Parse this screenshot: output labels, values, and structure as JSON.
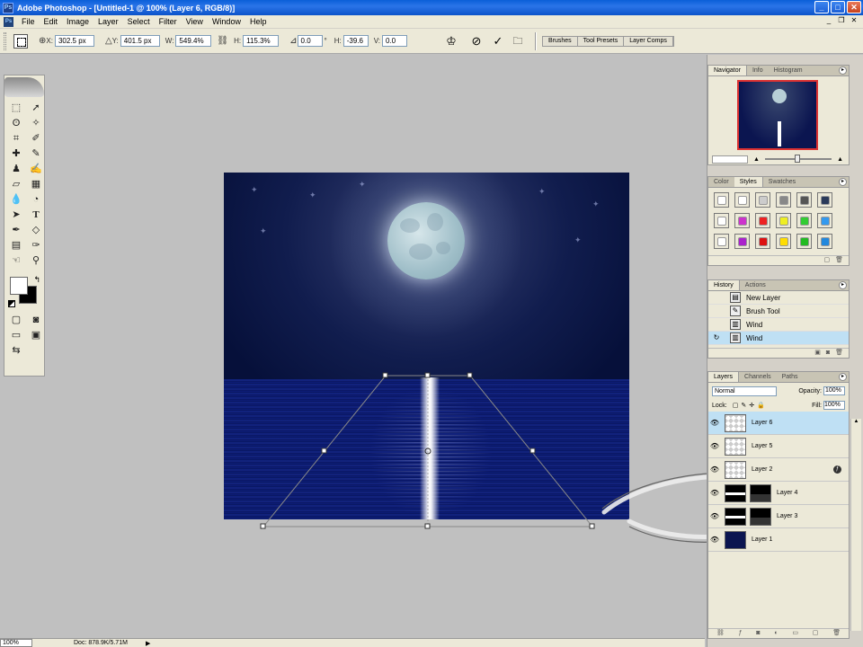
{
  "window": {
    "title": "Adobe Photoshop - [Untitled-1 @ 100% (Layer 6, RGB/8)]",
    "app_icon": "Ps"
  },
  "menu": {
    "items": [
      "File",
      "Edit",
      "Image",
      "Layer",
      "Select",
      "Filter",
      "View",
      "Window",
      "Help"
    ]
  },
  "options": {
    "x_label": "X:",
    "x_value": "302.5 px",
    "y_label": "Y:",
    "y_value": "401.5 px",
    "w_label": "W:",
    "w_value": "549.4%",
    "h_label": "H:",
    "h_value": "115.3%",
    "angle_value": "0.0",
    "h_skew_label": "H:",
    "h_skew_value": "-39.6",
    "v_skew_label": "V:",
    "v_skew_value": "0.0",
    "well_tabs": [
      "Brushes",
      "Tool Presets",
      "Layer Comps"
    ]
  },
  "navigator": {
    "tabs": [
      "Navigator",
      "Info",
      "Histogram"
    ]
  },
  "styles": {
    "tabs": [
      "Color",
      "Styles",
      "Swatches"
    ],
    "colors": [
      "#ffffff",
      "#ffffff",
      "#cccccc",
      "#888888",
      "#555555",
      "#2a3a5a",
      "#ffffff",
      "#cc33cc",
      "#ee2222",
      "#eeee22",
      "#33cc33",
      "#3399ee",
      "#ffffff",
      "#aa22cc",
      "#dd1111",
      "#ffdd00",
      "#22bb22",
      "#2288dd"
    ]
  },
  "history": {
    "tabs": [
      "History",
      "Actions"
    ],
    "items": [
      {
        "label": "New Layer",
        "icon": "new-layer-icon"
      },
      {
        "label": "Brush Tool",
        "icon": "brush-icon"
      },
      {
        "label": "Wind",
        "icon": "filter-icon"
      },
      {
        "label": "Wind",
        "icon": "filter-icon"
      }
    ]
  },
  "layers": {
    "tabs": [
      "Layers",
      "Channels",
      "Paths"
    ],
    "blend_mode": "Normal",
    "opacity_label": "Opacity:",
    "opacity_value": "100%",
    "fill_label": "Fill:",
    "fill_value": "100%",
    "items": [
      {
        "name": "Layer 6",
        "selected": true
      },
      {
        "name": "Layer 5"
      },
      {
        "name": "Layer 2"
      },
      {
        "name": "Layer 4"
      },
      {
        "name": "Layer 3"
      },
      {
        "name": "Layer 1"
      }
    ]
  },
  "status": {
    "zoom": "100%",
    "doc": "Doc: 878.9K/5.71M"
  },
  "icons": {
    "tool_icons": [
      "marquee-icon",
      "move-icon",
      "lasso-icon",
      "magic-wand-icon",
      "crop-icon",
      "slice-icon",
      "healing-icon",
      "brush-icon",
      "stamp-icon",
      "history-brush-icon",
      "eraser-icon",
      "gradient-icon",
      "blur-icon",
      "dodge-icon",
      "path-select-icon",
      "type-icon",
      "pen-icon",
      "shape-icon",
      "notes-icon",
      "eyedropper-icon",
      "hand-icon",
      "zoom-icon"
    ]
  }
}
